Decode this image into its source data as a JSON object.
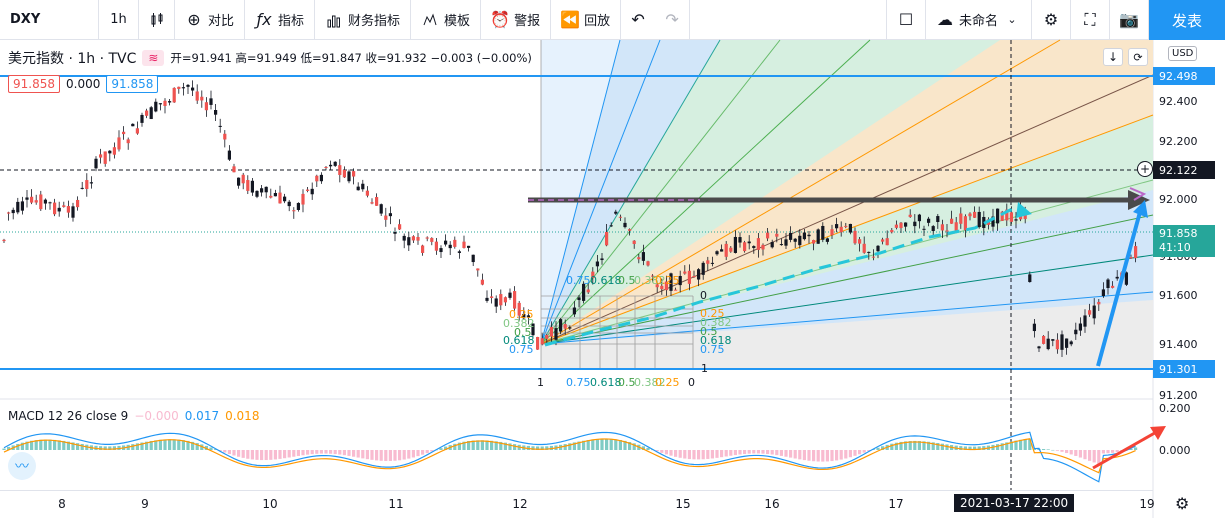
{
  "toolbar": {
    "symbol": "DXY",
    "interval": "1h",
    "compare": "对比",
    "indicators": "指标",
    "financials": "财务指标",
    "templates": "模板",
    "alerts": "警报",
    "replay": "回放",
    "layout_name": "未命名",
    "publish": "发表"
  },
  "legend": {
    "symbol_title": "美元指数 · 1h · TVC",
    "ohlc": "开=91.941 高=91.949 低=91.847 收=91.932 −0.003 (−0.00%)",
    "sell_price": "91.858",
    "spread": "0.000",
    "buy_price": "91.858"
  },
  "macd": {
    "name": "MACD 12 26 close 9",
    "hist": "−0.000",
    "macd": "0.017",
    "signal": "0.018"
  },
  "price_scale": {
    "currency": "USD",
    "labels": [
      "92.400",
      "92.200",
      "92.000",
      "91.800",
      "91.600",
      "91.400",
      "91.200"
    ],
    "macd_labels": [
      "0.200",
      "0.000"
    ],
    "box_top": "92.498",
    "box_cross": "92.122",
    "box_last": "91.858",
    "countdown": "41:10",
    "box_bottom": "91.301"
  },
  "time_axis": {
    "labels": [
      "8",
      "9",
      "10",
      "11",
      "12",
      "15",
      "16",
      "17",
      "19"
    ],
    "crosshair_label": "2021-03-17   22:00"
  },
  "fib_labels": {
    "left": [
      "0.75",
      "0.618",
      "0.5",
      "0.382",
      "0.25",
      "0.75",
      "0.618",
      "0.5",
      "0.382",
      "0.25"
    ],
    "right": [
      "0",
      "0.25",
      "0.382",
      "0.5",
      "0.618",
      "0.75"
    ],
    "bottom": [
      "1",
      "0.75",
      "0.618",
      "0.5",
      "0.382",
      "0.25",
      "0",
      "1"
    ]
  },
  "colors": {
    "up": "#26a69a",
    "down": "#ef5350",
    "accent": "#2196f3",
    "macd_line": "#2196f3",
    "signal_line": "#ff9800"
  }
}
